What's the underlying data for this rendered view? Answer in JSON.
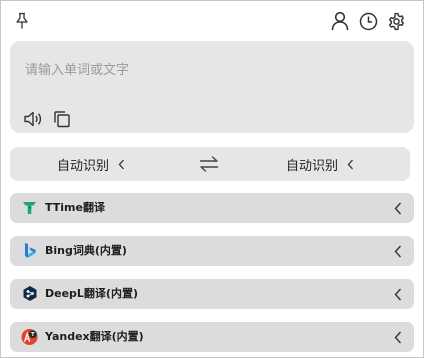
{
  "input": {
    "placeholder": "请输入单词或文字"
  },
  "languages": {
    "source": "自动识别",
    "target": "自动识别"
  },
  "services": [
    {
      "label": "TTime翻译",
      "icon": "ttime-logo-icon",
      "color": "#1aa67a"
    },
    {
      "label": "Bing词典(内置)",
      "icon": "bing-logo-icon",
      "color": "#2b7bd6"
    },
    {
      "label": "DeepL翻译(内置)",
      "icon": "deepl-logo-icon",
      "color": "#0f2b46"
    },
    {
      "label": "Yandex翻译(内置)",
      "icon": "yandex-logo-icon",
      "color": "#e0452a"
    }
  ],
  "icons": {
    "pin": "pin-icon",
    "user": "user-icon",
    "history": "history-clock-icon",
    "settings": "gear-icon",
    "speaker": "speaker-icon",
    "copy": "copy-icon",
    "swap": "swap-arrows-icon",
    "chevron": "chevron-left-icon"
  }
}
